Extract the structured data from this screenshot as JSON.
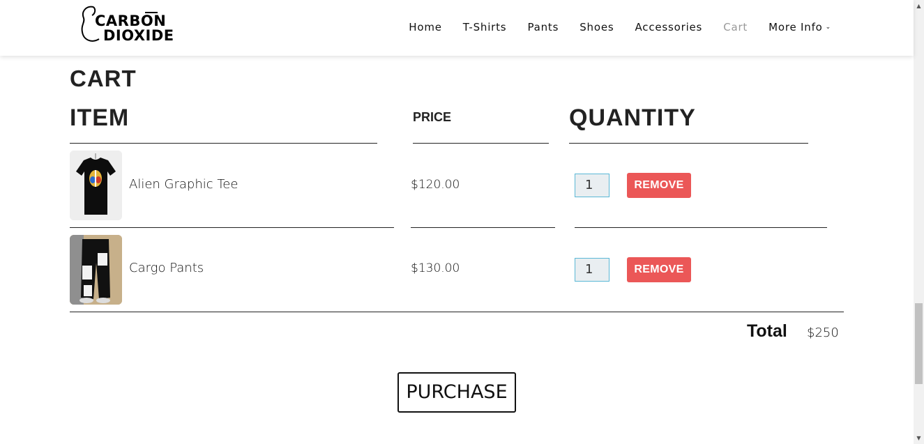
{
  "brand": {
    "line1": "CARBON",
    "line2": "DIOXIDE"
  },
  "nav": {
    "items": [
      {
        "label": "Home"
      },
      {
        "label": "T-Shirts"
      },
      {
        "label": "Pants"
      },
      {
        "label": "Shoes"
      },
      {
        "label": "Accessories"
      },
      {
        "label": "Cart"
      },
      {
        "label": "More Info"
      }
    ]
  },
  "page": {
    "title": "CART"
  },
  "table": {
    "headers": {
      "item": "ITEM",
      "price": "PRICE",
      "quantity": "QUANTITY"
    },
    "rows": [
      {
        "name": "Alien Graphic Tee",
        "price": "$120.00",
        "quantity": "1",
        "remove_label": "REMOVE"
      },
      {
        "name": "Cargo Pants",
        "price": "$130.00",
        "quantity": "1",
        "remove_label": "REMOVE"
      }
    ]
  },
  "summary": {
    "total_label": "Total",
    "total_value": "$250"
  },
  "actions": {
    "purchase_label": "PURCHASE"
  },
  "colors": {
    "remove": "#eb5757",
    "active_nav": "#999999",
    "input_border": "#5ab8d6"
  }
}
